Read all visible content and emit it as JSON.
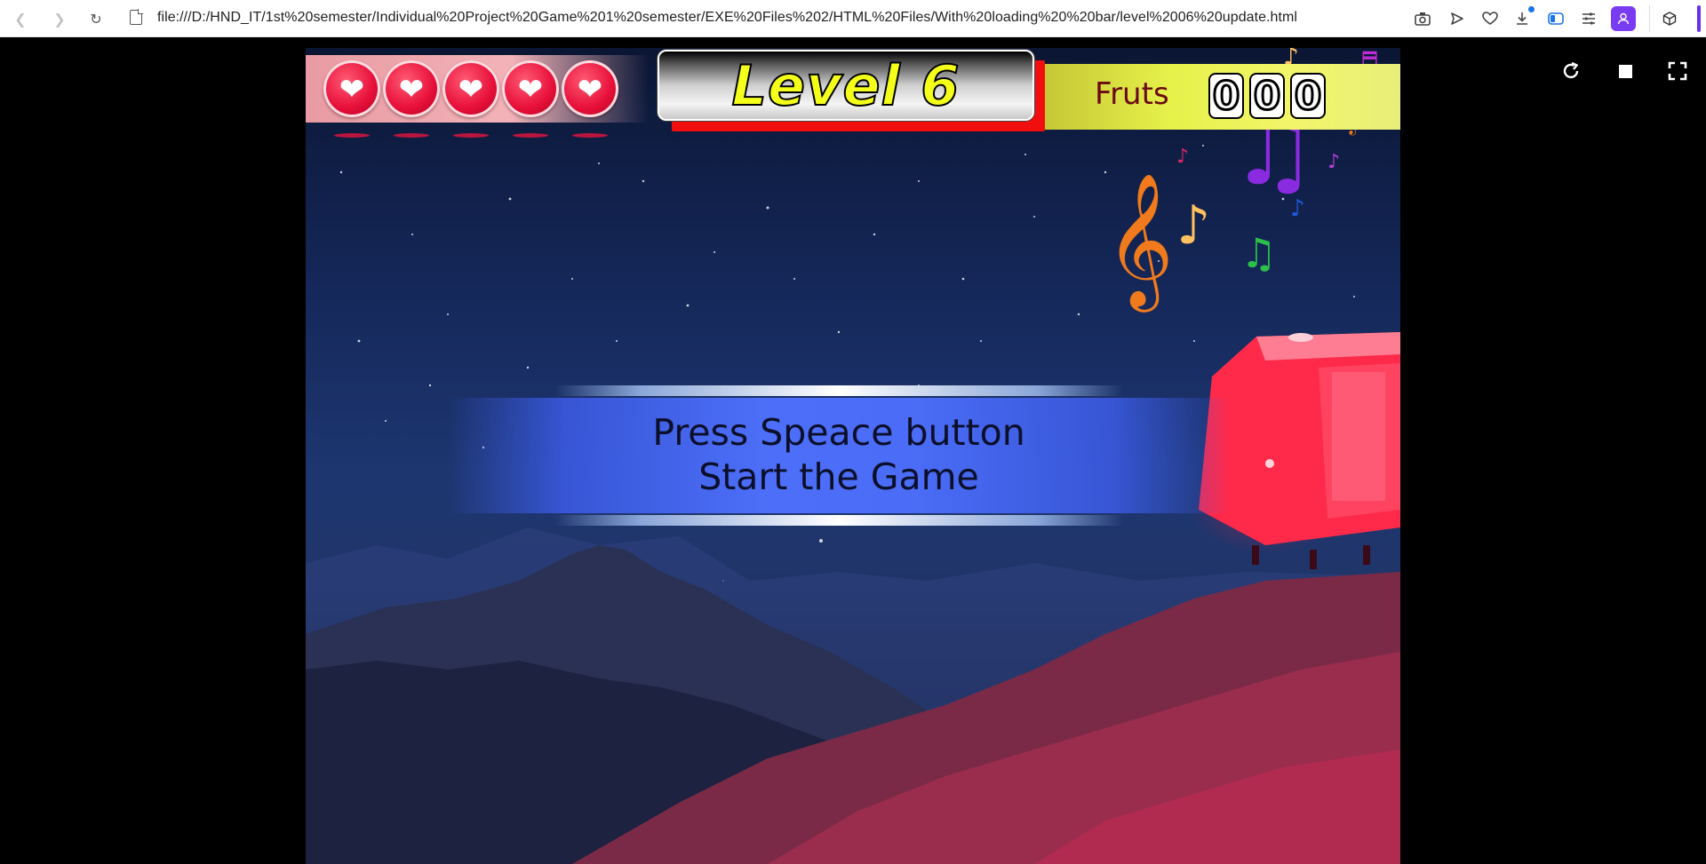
{
  "browser": {
    "url": "file:///D:/HND_IT/1st%20semester/Individual%20Project%20Game%201%20semester/EXE%20Files%202/HTML%20Files/With%20loading%20%20bar/level%2006%20update.html",
    "back_icon": "chevron-left-icon",
    "forward_icon": "chevron-right-icon",
    "reload_icon": "reload-icon",
    "toolbar_icons": [
      "camera-icon",
      "send-icon",
      "heart-icon",
      "download-icon",
      "sidebar-toggle-icon",
      "sliders-icon"
    ],
    "profile_icon": "person-icon",
    "extension_icon": "cube-icon",
    "accent": "#7a3cf0"
  },
  "viewer": {
    "controls": [
      "reload-icon",
      "stop-icon",
      "fullscreen-icon"
    ]
  },
  "game": {
    "lives": 5,
    "level_title": "Level 6",
    "fruits_label": "Fruts",
    "fruit_digits": [
      "0",
      "0",
      "0"
    ],
    "start_prompt": {
      "line1": "Press Speace button",
      "line2": "Start the Game"
    },
    "colors": {
      "heart": "#e8103a",
      "level_text": "#f4ff1a",
      "banner": "#4c6ef8",
      "fruits_panel": "#e6f14a"
    }
  }
}
